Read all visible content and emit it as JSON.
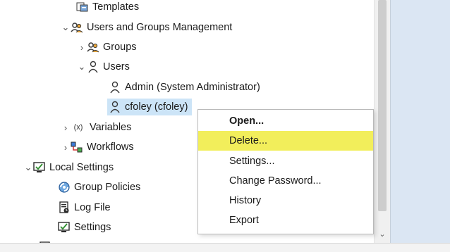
{
  "tree": {
    "items": [
      {
        "label": "Templates",
        "icon": "templates-icon"
      },
      {
        "label": "Users and Groups Management",
        "icon": "users-groups-icon"
      },
      {
        "label": "Groups",
        "icon": "groups-icon"
      },
      {
        "label": "Users",
        "icon": "user-icon"
      },
      {
        "label": "Admin (System Administrator)",
        "icon": "user-icon"
      },
      {
        "label": "cfoley (cfoley)",
        "icon": "user-icon"
      },
      {
        "label": "Variables",
        "icon": "variables-icon",
        "icon_text": "(x)"
      },
      {
        "label": "Workflows",
        "icon": "workflows-icon"
      },
      {
        "label": "Local Settings",
        "icon": "local-settings-icon"
      },
      {
        "label": "Group Policies",
        "icon": "group-policies-icon"
      },
      {
        "label": "Log File",
        "icon": "log-file-icon"
      },
      {
        "label": "Settings",
        "icon": "settings-icon"
      }
    ]
  },
  "context_menu": {
    "items": [
      {
        "label": "Open..."
      },
      {
        "label": "Delete..."
      },
      {
        "label": "Settings..."
      },
      {
        "label": "Change Password..."
      },
      {
        "label": "History"
      },
      {
        "label": "Export"
      }
    ],
    "highlight_color": "#f2ee5b",
    "default_item": "Open..."
  },
  "colors": {
    "selection": "#cce4f7",
    "right_pane": "#dbe6f3",
    "scrollbar_thumb": "#cdcdcd"
  }
}
